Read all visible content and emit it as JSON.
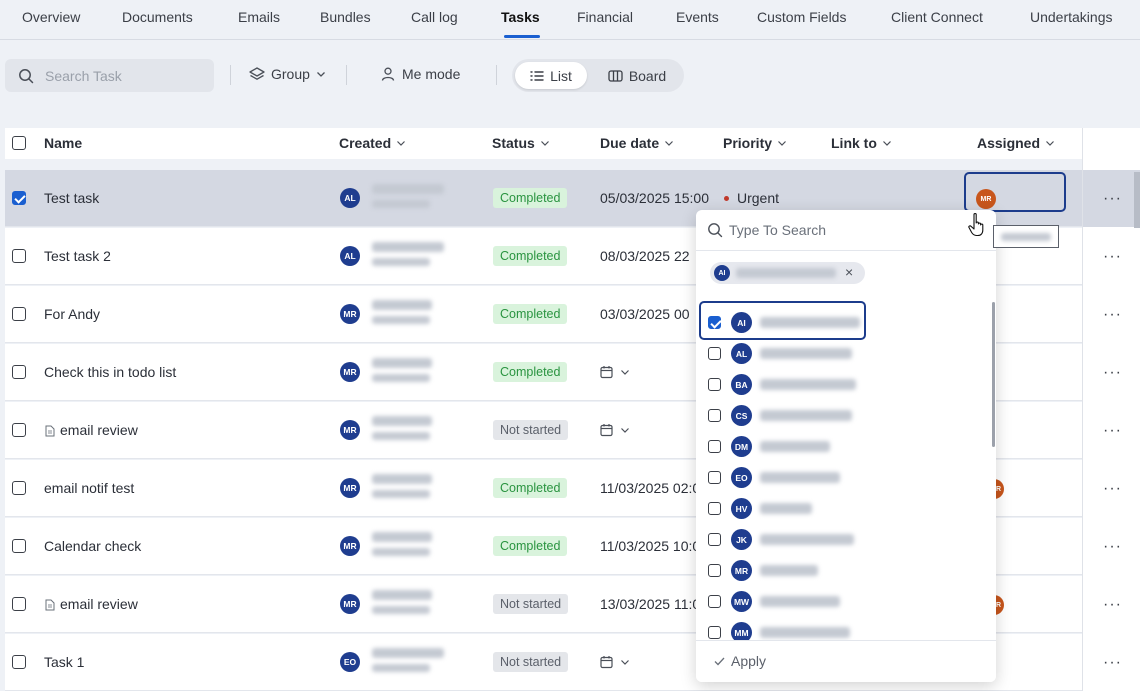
{
  "tabs": [
    {
      "label": "Overview"
    },
    {
      "label": "Documents"
    },
    {
      "label": "Emails"
    },
    {
      "label": "Bundles"
    },
    {
      "label": "Call log"
    },
    {
      "label": "Tasks"
    },
    {
      "label": "Financial"
    },
    {
      "label": "Events"
    },
    {
      "label": "Custom Fields"
    },
    {
      "label": "Client Connect"
    },
    {
      "label": "Undertakings"
    }
  ],
  "toolbar": {
    "search_placeholder": "Search Task",
    "group_label": "Group",
    "me_mode_label": "Me mode",
    "list_label": "List",
    "board_label": "Board"
  },
  "columns": {
    "name": "Name",
    "created": "Created",
    "status": "Status",
    "due": "Due date",
    "priority": "Priority",
    "link": "Link to",
    "assigned": "Assigned"
  },
  "rows": [
    {
      "name": "Test task",
      "created_initials": "AL",
      "status": "Completed",
      "due": "05/03/2025 15:00",
      "priority": "Urgent",
      "assigned": "MR"
    },
    {
      "name": "Test task 2",
      "created_initials": "AL",
      "status": "Completed",
      "due": "08/03/2025 22"
    },
    {
      "name": "For Andy",
      "created_initials": "MR",
      "status": "Completed",
      "due": "03/03/2025 00"
    },
    {
      "name": "Check this in todo list",
      "created_initials": "MR",
      "status": "Completed",
      "due": ""
    },
    {
      "name": "email review",
      "created_initials": "MR",
      "status": "Not started",
      "due": ""
    },
    {
      "name": "email notif test",
      "created_initials": "MR",
      "status": "Completed",
      "due": "11/03/2025 02:0",
      "assigned": "R"
    },
    {
      "name": "Calendar check",
      "created_initials": "MR",
      "status": "Completed",
      "due": "11/03/2025 10:0"
    },
    {
      "name": "email review",
      "created_initials": "MR",
      "status": "Not started",
      "due": "13/03/2025 11:0",
      "assigned": "R"
    },
    {
      "name": "Task 1",
      "created_initials": "EO",
      "status": "Not started",
      "due": ""
    }
  ],
  "dropdown": {
    "search_placeholder": "Type To Search",
    "chip_initials": "AI",
    "apply_label": "Apply",
    "users": [
      {
        "initials": "AI",
        "checked": true
      },
      {
        "initials": "AL",
        "checked": false
      },
      {
        "initials": "BA",
        "checked": false
      },
      {
        "initials": "CS",
        "checked": false
      },
      {
        "initials": "DM",
        "checked": false
      },
      {
        "initials": "EO",
        "checked": false
      },
      {
        "initials": "HV",
        "checked": false
      },
      {
        "initials": "JK",
        "checked": false
      },
      {
        "initials": "MR",
        "checked": false
      },
      {
        "initials": "MW",
        "checked": false
      },
      {
        "initials": "MM",
        "checked": false
      }
    ]
  },
  "colors": {
    "accent": "#1a5fd0",
    "avatar": "#1f3d8f",
    "assigned_avatar": "#c8561c",
    "completed_bg": "#d9f3dc",
    "completed_text": "#2a9440",
    "urgent": "#c0392b"
  }
}
